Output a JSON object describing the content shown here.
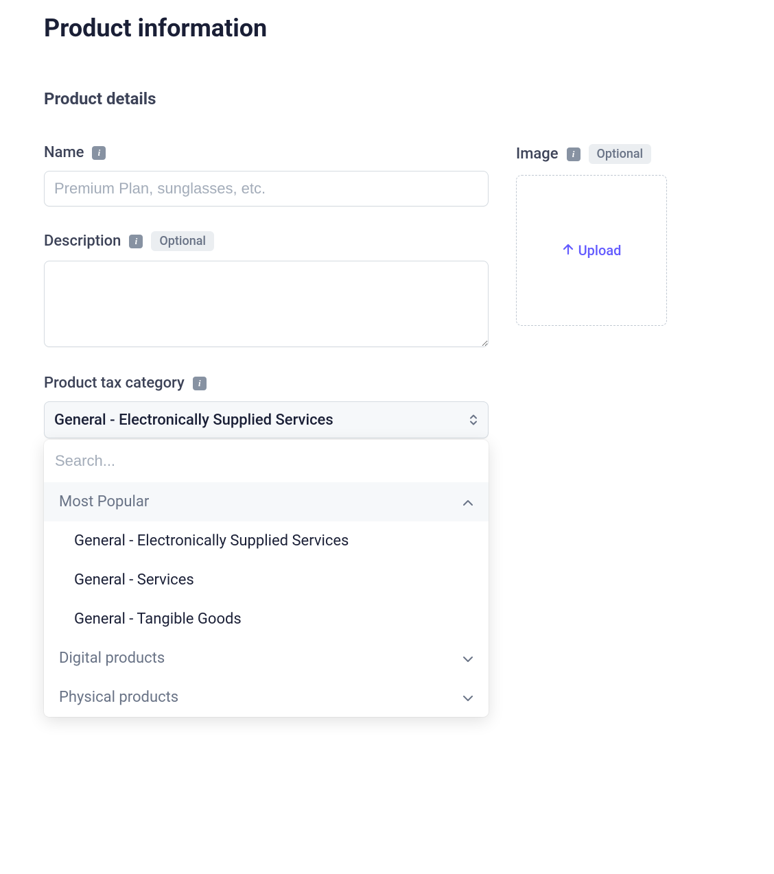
{
  "page": {
    "title": "Product information"
  },
  "section": {
    "title": "Product details"
  },
  "fields": {
    "name": {
      "label": "Name",
      "placeholder": "Premium Plan, sunglasses, etc.",
      "value": ""
    },
    "description": {
      "label": "Description",
      "optional": "Optional",
      "value": ""
    },
    "taxCategory": {
      "label": "Product tax category",
      "selected": "General - Electronically Supplied Services",
      "searchPlaceholder": "Search...",
      "groups": {
        "mostPopular": {
          "label": "Most Popular",
          "options": {
            "0": "General - Electronically Supplied Services",
            "1": "General - Services",
            "2": "General - Tangible Goods"
          }
        },
        "digital": {
          "label": "Digital products"
        },
        "physical": {
          "label": "Physical products"
        }
      }
    },
    "image": {
      "label": "Image",
      "optional": "Optional",
      "uploadLabel": "Upload"
    }
  }
}
